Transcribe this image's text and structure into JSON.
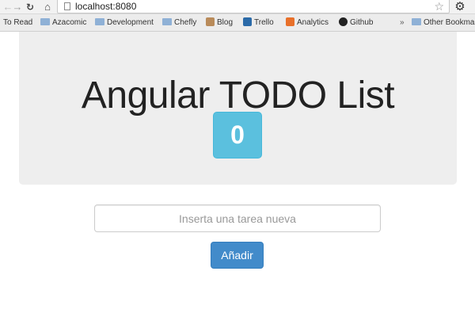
{
  "browser": {
    "url": "localhost:8080",
    "bookmarks": [
      {
        "label": "To Read",
        "icon": "bookmark-icon"
      },
      {
        "label": "Azacomic",
        "icon": "folder-icon"
      },
      {
        "label": "Development",
        "icon": "folder-icon"
      },
      {
        "label": "Chefly",
        "icon": "folder-icon"
      },
      {
        "label": "Blog",
        "icon": "blog-icon"
      },
      {
        "label": "Trello",
        "icon": "trello-icon"
      },
      {
        "label": "Analytics",
        "icon": "analytics-icon"
      },
      {
        "label": "Github",
        "icon": "github-icon"
      },
      {
        "label": "Other Bookmar",
        "icon": "folder-icon"
      }
    ],
    "overflow_label": "»"
  },
  "app": {
    "title": "Angular TODO List",
    "count": "0",
    "input_placeholder": "Inserta una tarea nueva",
    "input_value": "",
    "add_label": "Añadir"
  },
  "colors": {
    "badge": "#5bc0de",
    "button": "#428bca",
    "jumbotron": "#eeeeee"
  }
}
